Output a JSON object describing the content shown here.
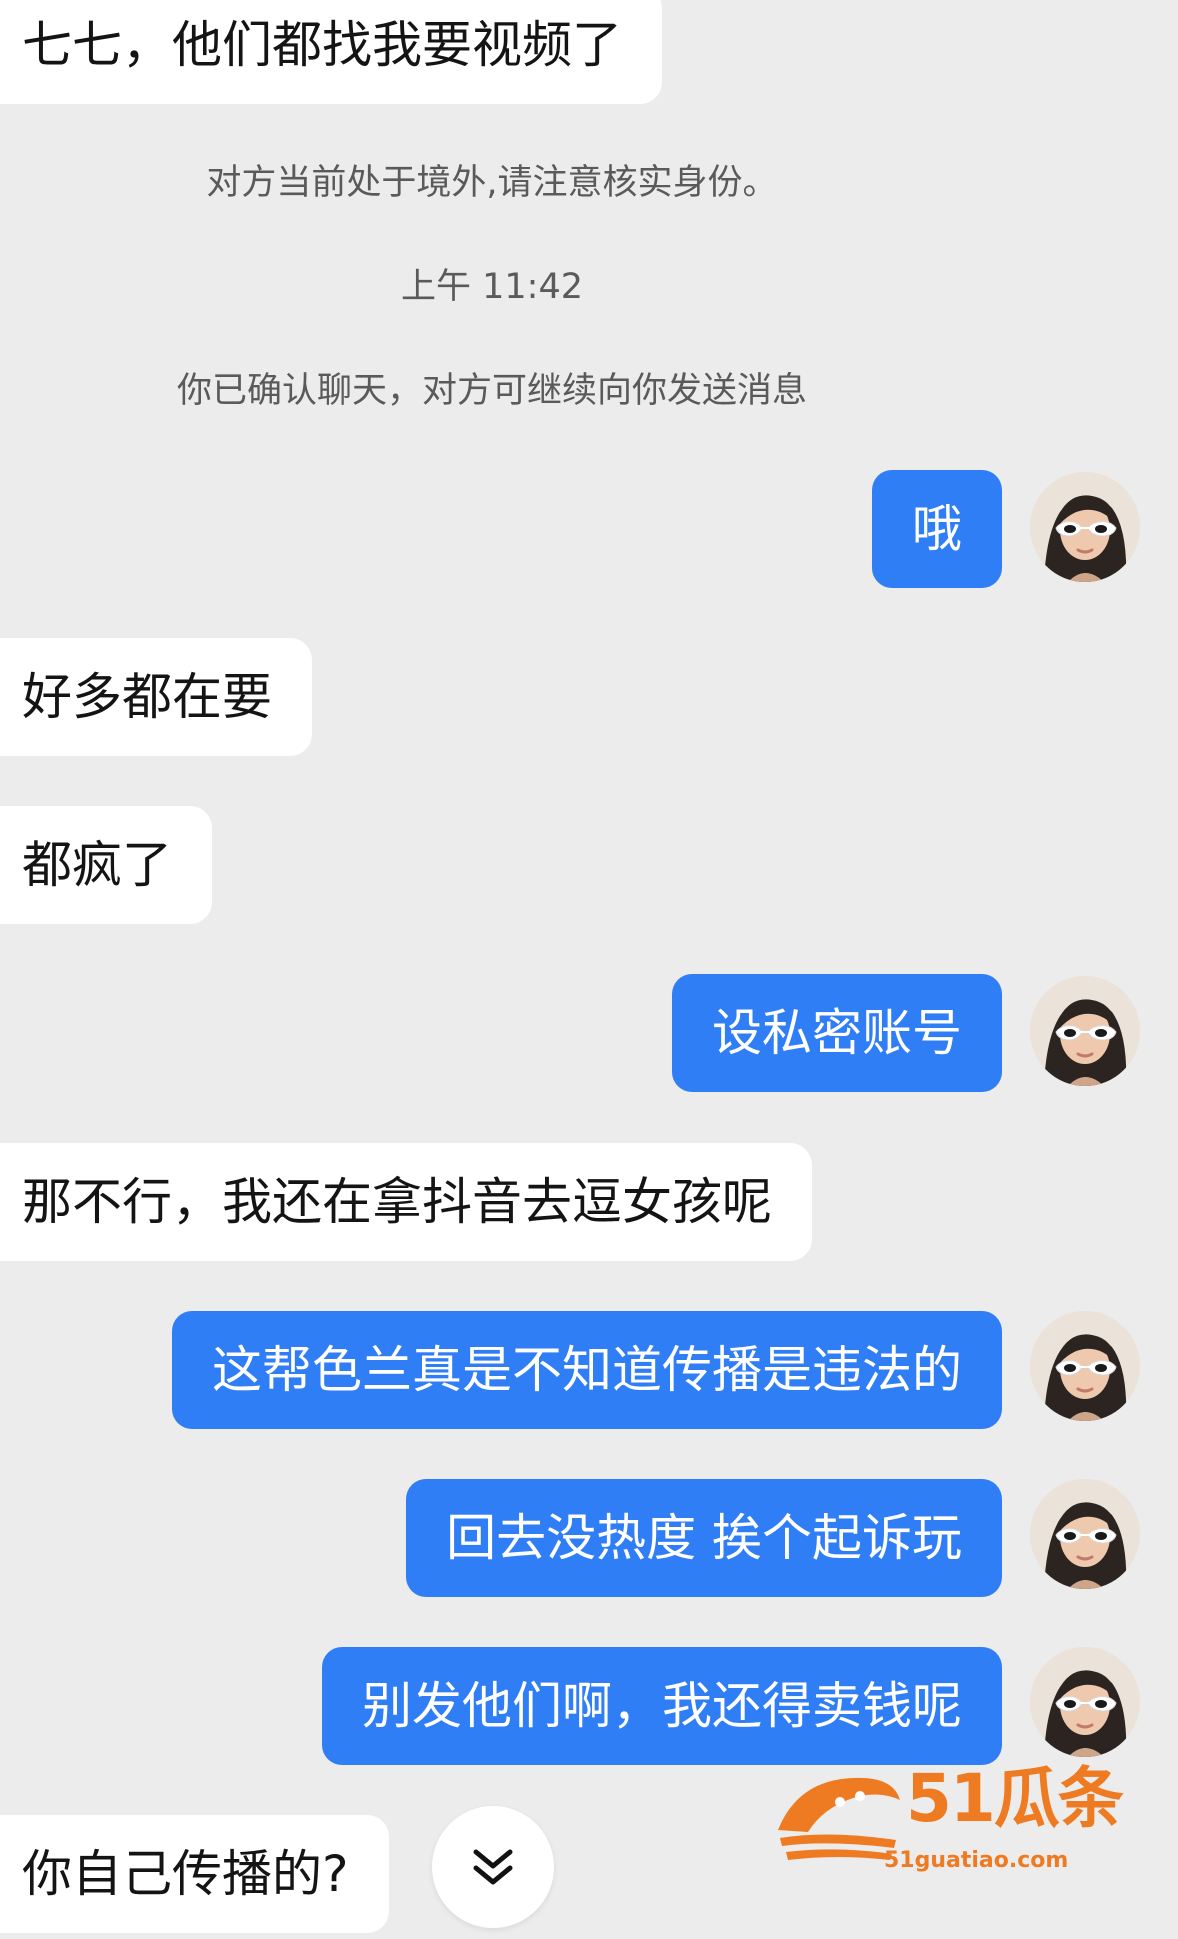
{
  "conversation": {
    "system": {
      "overseas_notice": "对方当前处于境外,请注意核实身份。",
      "timestamp": "上午 11:42",
      "confirmed_notice": "你已确认聊天，对方可继续向你发送消息"
    },
    "messages": [
      {
        "side": "incoming",
        "text": "七七，他们都找我要视频了"
      },
      {
        "side": "outgoing",
        "text": "哦"
      },
      {
        "side": "incoming",
        "text": "好多都在要"
      },
      {
        "side": "incoming",
        "text": "都疯了"
      },
      {
        "side": "outgoing",
        "text": "设私密账号"
      },
      {
        "side": "incoming",
        "text": "那不行，我还在拿抖音去逗女孩呢"
      },
      {
        "side": "outgoing",
        "text": "这帮色兰真是不知道传播是违法的"
      },
      {
        "side": "outgoing",
        "text": "回去没热度 挨个起诉玩"
      },
      {
        "side": "outgoing",
        "text": "别发他们啊，我还得卖钱呢"
      },
      {
        "side": "incoming",
        "text": "你自己传播的?"
      }
    ]
  },
  "scroll_button": {
    "icon": "double-chevron-down-icon"
  },
  "watermark": {
    "brand": "51瓜条",
    "url": "51guatiao.com",
    "color": "#ee7a22"
  },
  "colors": {
    "background": "#ececec",
    "incoming_bubble": "#ffffff",
    "outgoing_bubble": "#2f7ef6",
    "outgoing_text": "#ffffff"
  }
}
